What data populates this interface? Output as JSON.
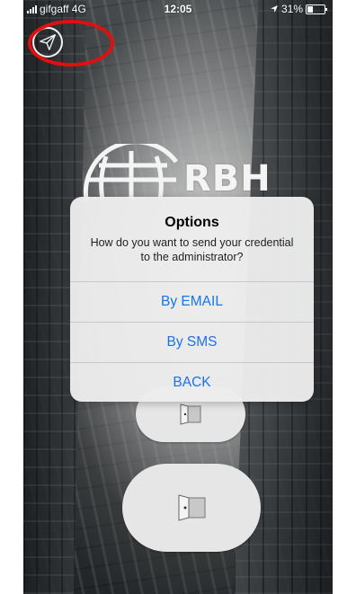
{
  "status_bar": {
    "carrier": "gifgaff 4G",
    "time": "12:05",
    "battery_percent": "31%",
    "battery_level": 0.31,
    "location_icon": "location-arrow-icon"
  },
  "header": {
    "send_icon": "paper-plane-icon"
  },
  "logo": {
    "text": "RBH"
  },
  "dialog": {
    "title": "Options",
    "message": "How do you want to send your credential to the administrator?",
    "options": [
      {
        "label": "By EMAIL"
      },
      {
        "label": "By SMS"
      },
      {
        "label": "BACK"
      }
    ]
  },
  "colors": {
    "accent": "#1a73e8",
    "highlight": "#e01010"
  }
}
